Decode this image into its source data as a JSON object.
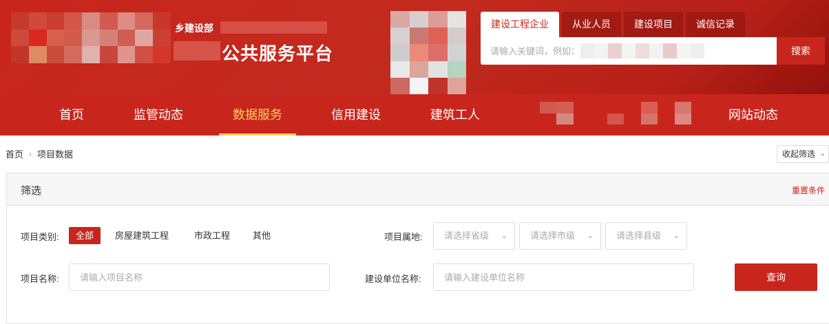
{
  "header": {
    "title_top": "乡建设部",
    "title_main": "公共服务平台",
    "search_tabs": [
      "建设工程企业",
      "从业人员",
      "建设项目",
      "诚信记录"
    ],
    "search_placeholder": "请输入关键词，例如：",
    "search_button": "搜索"
  },
  "nav": {
    "items": [
      "首页",
      "监管动态",
      "数据服务",
      "信用建设",
      "建筑工人",
      "网站动态"
    ],
    "active": "数据服务"
  },
  "breadcrumb": {
    "home": "首页",
    "separator": "›",
    "current": "项目数据"
  },
  "collapse_label": "收起筛选",
  "filter": {
    "title": "筛选",
    "reset": "重置条件",
    "type_label": "项目类别:",
    "type_options": [
      "全部",
      "房屋建筑工程",
      "市政工程",
      "其他"
    ],
    "active_type": "全部",
    "location_label": "项目属地:",
    "province_placeholder": "请选择省级",
    "city_placeholder": "请选择市级",
    "county_placeholder": "请选择县级",
    "name_label": "项目名称:",
    "name_placeholder": "请输入项目名称",
    "unit_label": "建设单位名称:",
    "unit_placeholder": "请输入建设单位名称",
    "query_button": "查询"
  },
  "colors": {
    "brand_red": "#c8261c",
    "active_nav": "#ffd25a"
  }
}
